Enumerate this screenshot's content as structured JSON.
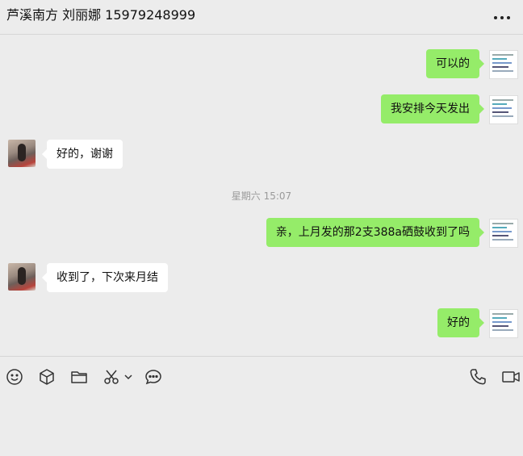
{
  "header": {
    "title": "芦溪南方 刘丽娜 15979248999",
    "more_icon": "more-icon"
  },
  "messages": [
    {
      "direction": "out",
      "text": "可以的"
    },
    {
      "direction": "out",
      "text": "我安排今天发出"
    },
    {
      "direction": "in",
      "text": "好的，谢谢"
    },
    {
      "direction": "time",
      "text": "星期六 15:07"
    },
    {
      "direction": "out",
      "text": "亲，上月发的那2支388a硒鼓收到了吗"
    },
    {
      "direction": "in",
      "text": "收到了，下次来月结"
    },
    {
      "direction": "out",
      "text": "好的"
    }
  ],
  "toolbar": {
    "left_icons": [
      "emoji-icon",
      "cube-icon",
      "folder-icon",
      "scissors-icon",
      "chevron-down-icon",
      "chat-bubble-icon"
    ],
    "right_icons": [
      "phone-icon",
      "video-call-icon"
    ]
  },
  "colors": {
    "outgoing_bubble": "#95ec69",
    "incoming_bubble": "#ffffff",
    "background": "#ececec"
  }
}
